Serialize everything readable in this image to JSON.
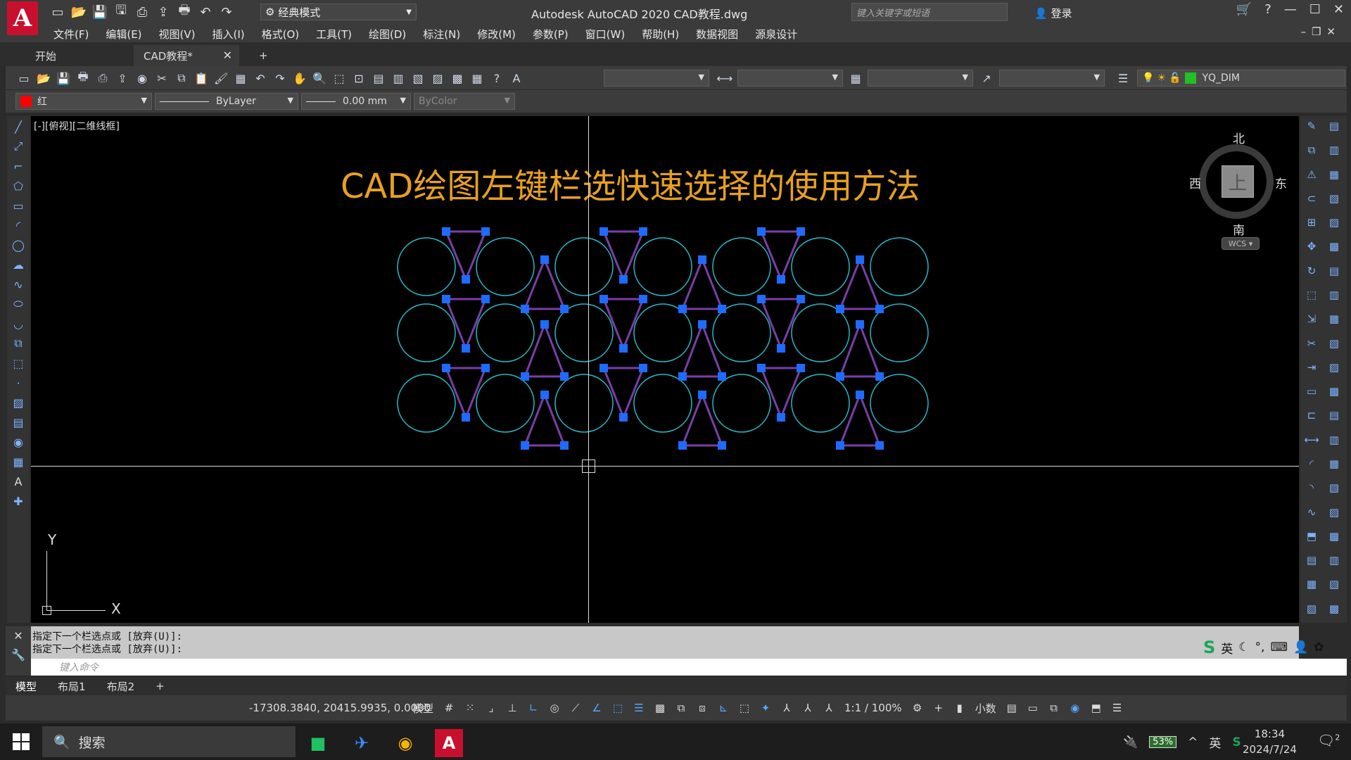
{
  "app": {
    "logo": "A",
    "workspace": "经典模式",
    "title": "Autodesk AutoCAD 2020    CAD教程.dwg",
    "search_placeholder": "键入关键字或短语",
    "login": "登录"
  },
  "menu": [
    "文件(F)",
    "编辑(E)",
    "视图(V)",
    "插入(I)",
    "格式(O)",
    "工具(T)",
    "绘图(D)",
    "标注(N)",
    "修改(M)",
    "参数(P)",
    "窗口(W)",
    "帮助(H)",
    "数据视图",
    "源泉设计"
  ],
  "tabs": [
    {
      "label": "开始"
    },
    {
      "label": "CAD教程*"
    }
  ],
  "toolbar": {
    "layer_name": "YQ_DIM",
    "color": "红",
    "color_hex": "#ff0000",
    "linetype": "ByLayer",
    "lineweight": "0.00 mm",
    "plotstyle": "ByColor"
  },
  "canvas": {
    "view_label": "[-][俯视][二维线框]",
    "drawing_title": "CAD绘图左键栏选快速选择的使用方法",
    "title_color": "#e8a020",
    "circle_color": "#27b7c6",
    "triangle_color": "#7a3ea8",
    "grip_color": "#1e6bff",
    "viewcube": {
      "north": "北",
      "south": "南",
      "east": "东",
      "west": "西",
      "face": "上",
      "wcs": "WCS"
    },
    "ucs": {
      "x": "X",
      "y": "Y"
    }
  },
  "command": {
    "history": [
      "指定下一个栏选点或 [放弃(U)]:",
      "指定下一个栏选点或 [放弃(U)]:"
    ],
    "placeholder": "键入命令"
  },
  "ime": {
    "lang": "英"
  },
  "layout_tabs": [
    "模型",
    "布局1",
    "布局2"
  ],
  "status": {
    "coords": "-17308.3840, 20415.9935, 0.0000",
    "model": "模型",
    "scale": "1:1 / 100%",
    "units": "小数"
  },
  "taskbar": {
    "search": "搜索",
    "battery": "53%",
    "lang": "英",
    "time": "18:34",
    "date": "2024/7/24",
    "notifications": "2"
  }
}
